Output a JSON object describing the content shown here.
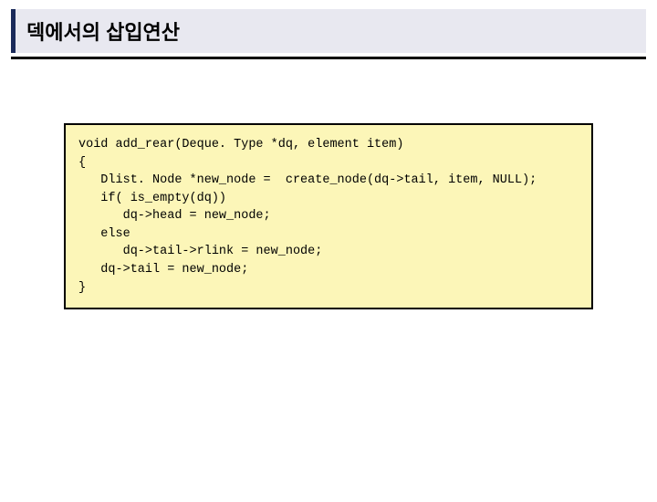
{
  "header": {
    "title": "덱에서의 삽입연산"
  },
  "code": {
    "lines": [
      "void add_rear(Deque. Type *dq, element item)",
      "{",
      "   Dlist. Node *new_node =  create_node(dq->tail, item, NULL);",
      "   if( is_empty(dq))",
      "      dq->head = new_node;",
      "   else",
      "      dq->tail->rlink = new_node;",
      "   dq->tail = new_node;",
      "}"
    ]
  }
}
